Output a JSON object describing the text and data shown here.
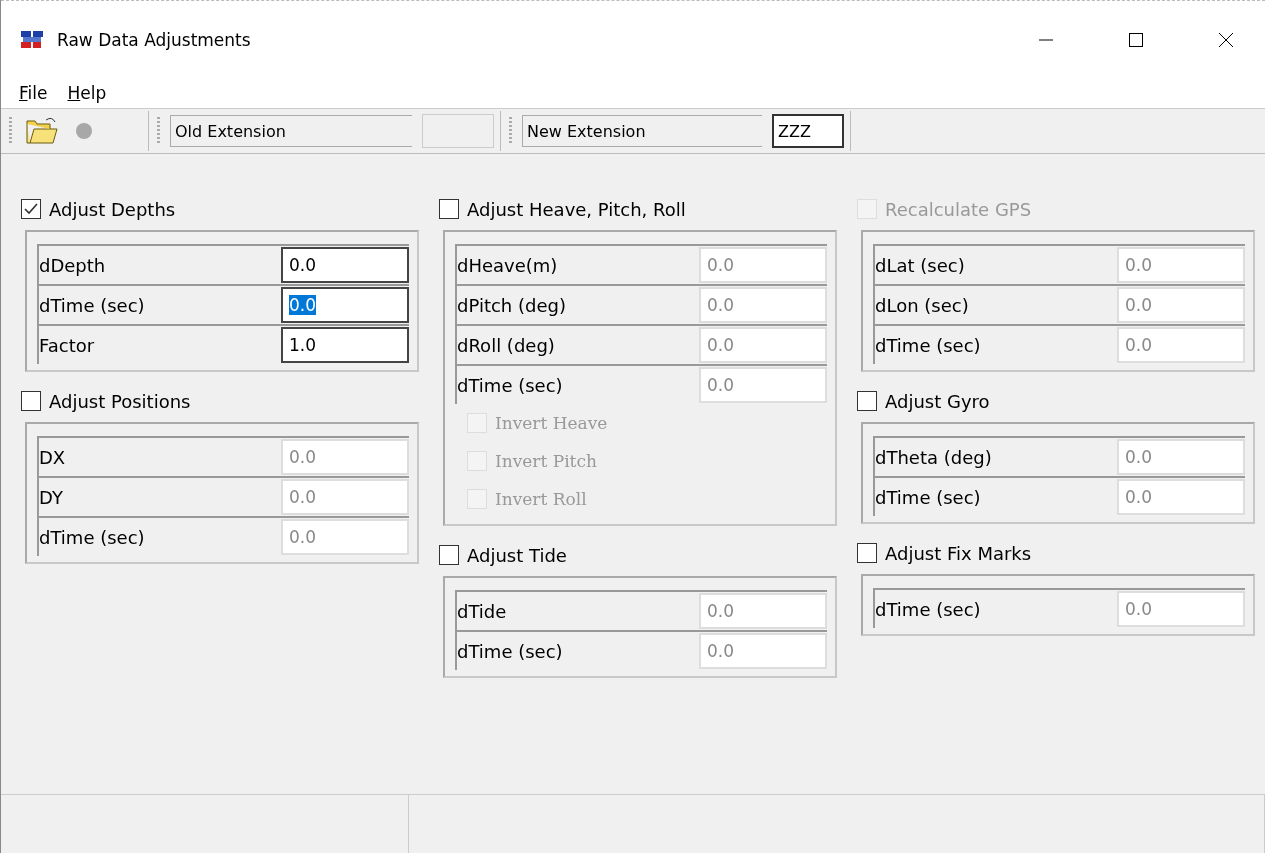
{
  "window": {
    "title": "Raw Data Adjustments"
  },
  "menu": [
    {
      "label": "File"
    },
    {
      "label": "Help"
    }
  ],
  "toolbar": {
    "old_extension": {
      "label": "Old Extension",
      "disabled": true
    },
    "new_extension": {
      "label": "New Extension",
      "value": "ZZZ",
      "disabled": false
    }
  },
  "columns": [
    {
      "sections": [
        {
          "label": "Adjust Depths",
          "checked": true,
          "disabled": false,
          "rows": [
            {
              "label": "dDepth",
              "value": "0.0",
              "disabled": false,
              "text_selected": false
            },
            {
              "label": "dTime (sec)",
              "value": "0.0",
              "disabled": false,
              "text_selected": true
            },
            {
              "label": "Factor",
              "value": "1.0",
              "disabled": false,
              "text_selected": false
            }
          ]
        },
        {
          "label": "Adjust Positions",
          "checked": false,
          "disabled": false,
          "rows": [
            {
              "label": "DX",
              "value": "0.0",
              "disabled": true,
              "text_selected": false
            },
            {
              "label": "DY",
              "value": "0.0",
              "disabled": true,
              "text_selected": false
            },
            {
              "label": "dTime (sec)",
              "value": "0.0",
              "disabled": true,
              "text_selected": false
            }
          ]
        }
      ]
    },
    {
      "sections": [
        {
          "label": "Adjust Heave, Pitch, Roll",
          "checked": false,
          "disabled": false,
          "rows": [
            {
              "label": "dHeave(m)",
              "value": "0.0",
              "disabled": true,
              "text_selected": false
            },
            {
              "label": "dPitch (deg)",
              "value": "0.0",
              "disabled": true,
              "text_selected": false
            },
            {
              "label": "dRoll (deg)",
              "value": "0.0",
              "disabled": true,
              "text_selected": false
            },
            {
              "label": "dTime (sec)",
              "value": "0.0",
              "disabled": true,
              "text_selected": false
            }
          ],
          "options": [
            {
              "label": "Invert Heave",
              "checked": false,
              "disabled": true
            },
            {
              "label": "Invert Pitch",
              "checked": false,
              "disabled": true
            },
            {
              "label": "Invert Roll",
              "checked": false,
              "disabled": true
            }
          ]
        },
        {
          "label": "Adjust Tide",
          "checked": false,
          "disabled": false,
          "rows": [
            {
              "label": "dTide",
              "value": "0.0",
              "disabled": true,
              "text_selected": false
            },
            {
              "label": "dTime (sec)",
              "value": "0.0",
              "disabled": true,
              "text_selected": false
            }
          ]
        }
      ]
    },
    {
      "sections": [
        {
          "label": "Recalculate GPS",
          "checked": false,
          "disabled": true,
          "rows": [
            {
              "label": "dLat (sec)",
              "value": "0.0",
              "disabled": true,
              "text_selected": false
            },
            {
              "label": "dLon (sec)",
              "value": "0.0",
              "disabled": true,
              "text_selected": false
            },
            {
              "label": "dTime (sec)",
              "value": "0.0",
              "disabled": true,
              "text_selected": false
            }
          ]
        },
        {
          "label": "Adjust Gyro",
          "checked": false,
          "disabled": false,
          "rows": [
            {
              "label": "dTheta (deg)",
              "value": "0.0",
              "disabled": true,
              "text_selected": false
            },
            {
              "label": "dTime (sec)",
              "value": "0.0",
              "disabled": true,
              "text_selected": false
            }
          ]
        },
        {
          "label": "Adjust Fix Marks",
          "checked": false,
          "disabled": false,
          "rows": [
            {
              "label": "dTime (sec)",
              "value": "0.0",
              "disabled": true,
              "text_selected": false
            }
          ]
        }
      ]
    }
  ]
}
